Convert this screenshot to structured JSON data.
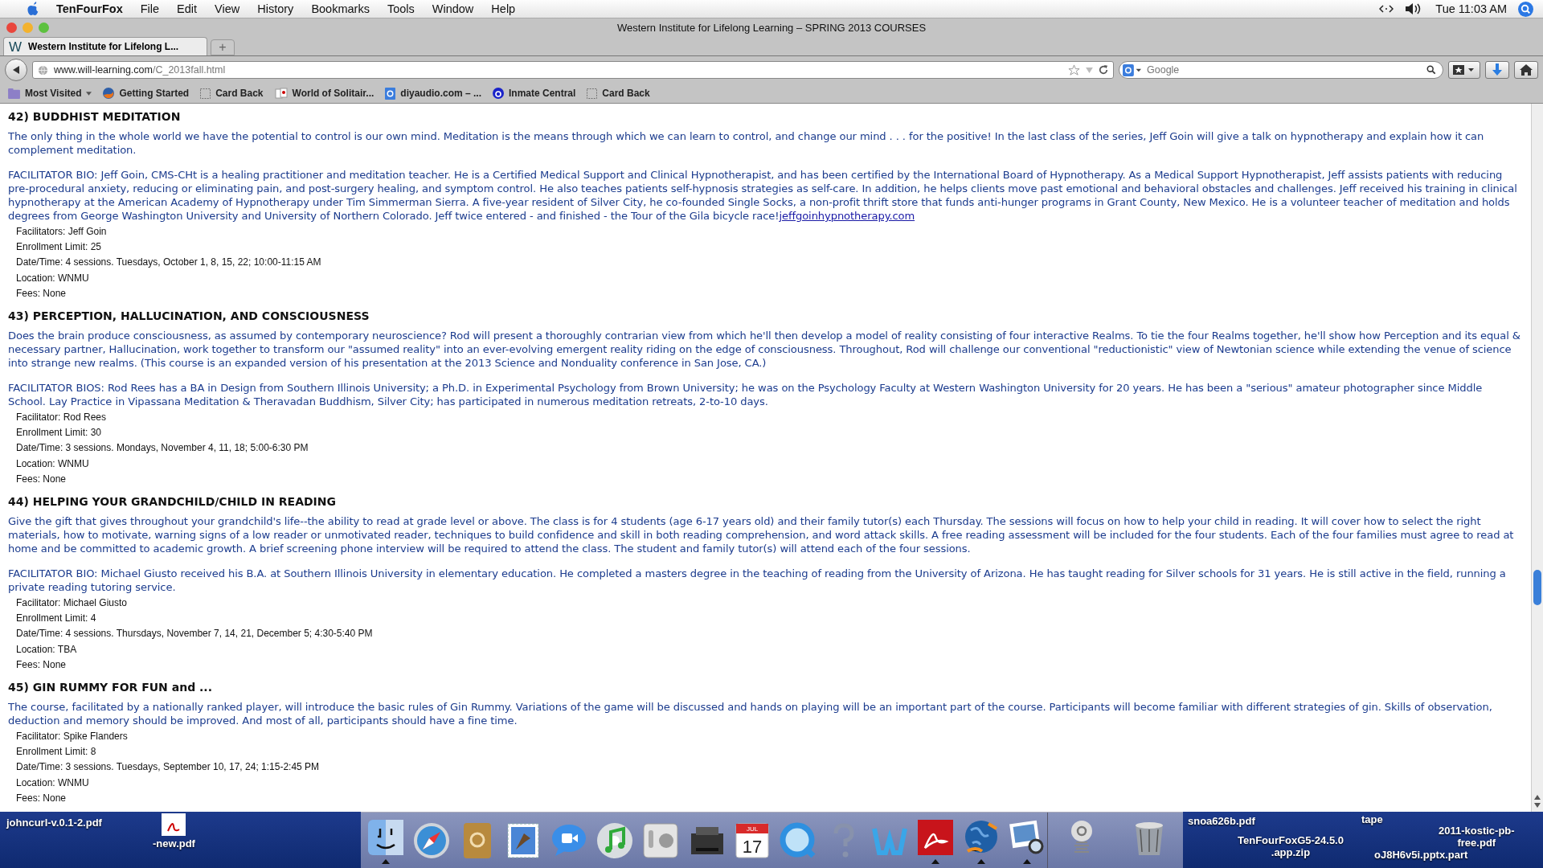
{
  "menubar": {
    "app": "TenFourFox",
    "menus": [
      "File",
      "Edit",
      "View",
      "History",
      "Bookmarks",
      "Tools",
      "Window",
      "Help"
    ],
    "clock": "Tue 11:03 AM"
  },
  "window": {
    "title": "Western Institute for Lifelong Learning – SPRING 2013 COURSES"
  },
  "tabs": [
    {
      "favicon": "W",
      "label": "Western Institute for Lifelong L...",
      "selected": true
    }
  ],
  "new_tab": "+",
  "url": {
    "host": "www.will-learning.com",
    "path": "/C_2013fall.html"
  },
  "search": {
    "placeholder": "Google"
  },
  "bookmarks": [
    {
      "kind": "folder",
      "label": "Most Visited"
    },
    {
      "kind": "fox",
      "label": "Getting Started"
    },
    {
      "kind": "blank",
      "label": "Card Back"
    },
    {
      "kind": "cards",
      "label": "World of Solitair..."
    },
    {
      "kind": "google",
      "label": "diyaudio.com – ..."
    },
    {
      "kind": "a",
      "label": "Inmate Central"
    },
    {
      "kind": "blank",
      "label": "Card Back"
    }
  ],
  "courses": [
    {
      "heading": "42) BUDDHIST MEDITATION",
      "paragraphs": [
        {
          "text": "The only thing in the whole world we have the potential to control is our own mind. Meditation is the means through which we can learn to control, and change our mind . . . for the positive! In the last class of the series, Jeff Goin will give a talk on hypnotherapy and explain how it can complement meditation."
        },
        {
          "text": "FACILITATOR BIO: Jeff Goin, CMS-CHt is a healing practitioner and meditation teacher. He is a Certified Medical Support and Clinical Hypnotherapist, and has been certified by the International Board of Hypnotherapy. As a Medical Support Hypnotherapist, Jeff assists patients with reducing pre-procedural anxiety, reducing or eliminating pain, and post-surgery healing, and symptom control. He also teaches patients self-hypnosis strategies as self-care. In addition, he helps clients move past emotional and behavioral obstacles and challenges. Jeff received his training in clinical hypnotherapy at the American Academy of Hypnotherapy under Tim Simmerman Sierra. A five-year resident of Silver City, he co-founded Single Socks, a non-profit thrift store that funds anti-hunger programs in Grant County, New Mexico. He is a volunteer teacher of meditation and holds degrees from George Washington University and University of Northern Colorado. Jeff twice entered - and finished - the Tour of the Gila bicycle race!",
          "link": "jeffgoinhypnotherapy.com"
        }
      ],
      "details": [
        "Facilitators: Jeff Goin",
        "Enrollment Limit: 25",
        "Date/Time: 4 sessions. Tuesdays, October 1, 8, 15, 22; 10:00-11:15 AM",
        "Location: WNMU",
        "Fees: None"
      ]
    },
    {
      "heading": "43) PERCEPTION, HALLUCINATION, AND CONSCIOUSNESS",
      "paragraphs": [
        {
          "text": "Does the brain produce consciousness, as assumed by contemporary neuroscience? Rod will present a thoroughly contrarian view from which he'll then develop a model of reality consisting of four interactive Realms. To tie the four Realms together, he'll show how Perception and its equal & necessary partner, Hallucination, work together to transform our \"assumed reality\" into an ever-evolving emergent reality riding on the edge of consciousness. Throughout, Rod will challenge our conventional \"reductionistic\" view of Newtonian science while extending the venue of science into strange new realms. (This course is an expanded version of his presentation at the 2013 Science and Nonduality conference in San Jose, CA.)"
        },
        {
          "text": "FACILITATOR BIOS: Rod Rees has a BA in Design from Southern Illinois University; a Ph.D. in Experimental Psychology from Brown University; he was on the Psychology Faculty at Western Washington University for 20 years. He has been a \"serious\" amateur photographer since Middle School. Lay Practice in Vipassana Meditation & Theravadan Buddhism, Silver City; has participated in numerous meditation retreats, 2-to-10 days."
        }
      ],
      "details": [
        "Facilitator: Rod Rees",
        "Enrollment Limit: 30",
        "Date/Time: 3 sessions. Mondays, November 4, 11, 18; 5:00-6:30 PM",
        "Location: WNMU",
        "Fees: None"
      ]
    },
    {
      "heading": "44) HELPING YOUR GRANDCHILD/CHILD IN READING",
      "paragraphs": [
        {
          "text": "Give the gift that gives throughout your grandchild's life--the ability to read at grade level or above. The class is for 4 students (age 6-17 years old) and their family tutor(s) each Thursday. The sessions will focus on how to help your child in reading. It will cover how to select the right materials, how to motivate, warning signs of a low reader or unmotivated reader, techniques to build confidence and skill in both reading comprehension, and word attack skills. A free reading assessment will be included for the four students. Each of the four families must agree to read at home and be committed to academic growth. A brief screening phone interview will be required to attend the class. The student and family tutor(s) will attend each of the four sessions."
        },
        {
          "text": "FACILITATOR BIO: Michael Giusto received his B.A. at Southern Illinois University in elementary education. He completed a masters degree in the teaching of reading from the University of Arizona. He has taught reading for Silver schools for 31 years. He is still active in the field, running a private reading tutoring service."
        }
      ],
      "details": [
        "Facilitator: Michael Giusto",
        "Enrollment Limit: 4",
        "Date/Time: 4 sessions. Thursdays, November 7, 14, 21, December 5; 4:30-5:40 PM",
        "Location: TBA",
        "Fees: None"
      ]
    },
    {
      "heading": "45) GIN RUMMY FOR FUN and ...",
      "paragraphs": [
        {
          "text": "The course, facilitated by a nationally ranked player, will introduce the basic rules of Gin Rummy. Variations of the game will be discussed and hands on playing will be an important part of the course. Participants will become familiar with different strategies of gin. Skills of observation, deduction and memory should be improved. And most of all, participants should have a fine time."
        }
      ],
      "details": [
        "Facilitator: Spike Flanders",
        "Enrollment Limit: 8",
        "Date/Time: 3 sessions. Tuesdays, September 10, 17, 24; 1:15-2:45 PM",
        "Location: WNMU",
        "Fees: None"
      ]
    }
  ],
  "desktop_left": [
    {
      "kind": "file",
      "label": "johncurl-v.0.1-2.pdf"
    },
    {
      "kind": "pdf",
      "label": "-new.pdf"
    }
  ],
  "dock": {
    "apps": [
      {
        "kind": "finder",
        "running": true
      },
      {
        "kind": "safari",
        "running": false
      },
      {
        "kind": "addressbook",
        "running": false
      },
      {
        "kind": "mail",
        "running": false
      },
      {
        "kind": "ichat",
        "running": false
      },
      {
        "kind": "itunes",
        "running": false
      },
      {
        "kind": "prefs",
        "running": false
      },
      {
        "kind": "printer",
        "running": false
      },
      {
        "kind": "ical",
        "running": false,
        "month": "JUL",
        "day": "17"
      },
      {
        "kind": "quicktime",
        "running": false
      },
      {
        "kind": "help",
        "running": false
      },
      {
        "kind": "word",
        "running": false
      },
      {
        "kind": "acrobat",
        "running": true
      },
      {
        "kind": "globe",
        "running": true
      },
      {
        "kind": "preview",
        "running": true
      }
    ],
    "stacks": [
      {
        "kind": "at"
      },
      {
        "kind": "trash"
      }
    ]
  },
  "desktop_right": [
    {
      "label": "snoa626b.pdf"
    },
    {
      "label": "TenFourFoxG5-24.5.0\n.app.zip"
    },
    {
      "label": "tape"
    },
    {
      "label": "oJ8H6v5i.pptx.part"
    },
    {
      "label": "2011-kostic-pb-\nfree.pdf"
    }
  ]
}
